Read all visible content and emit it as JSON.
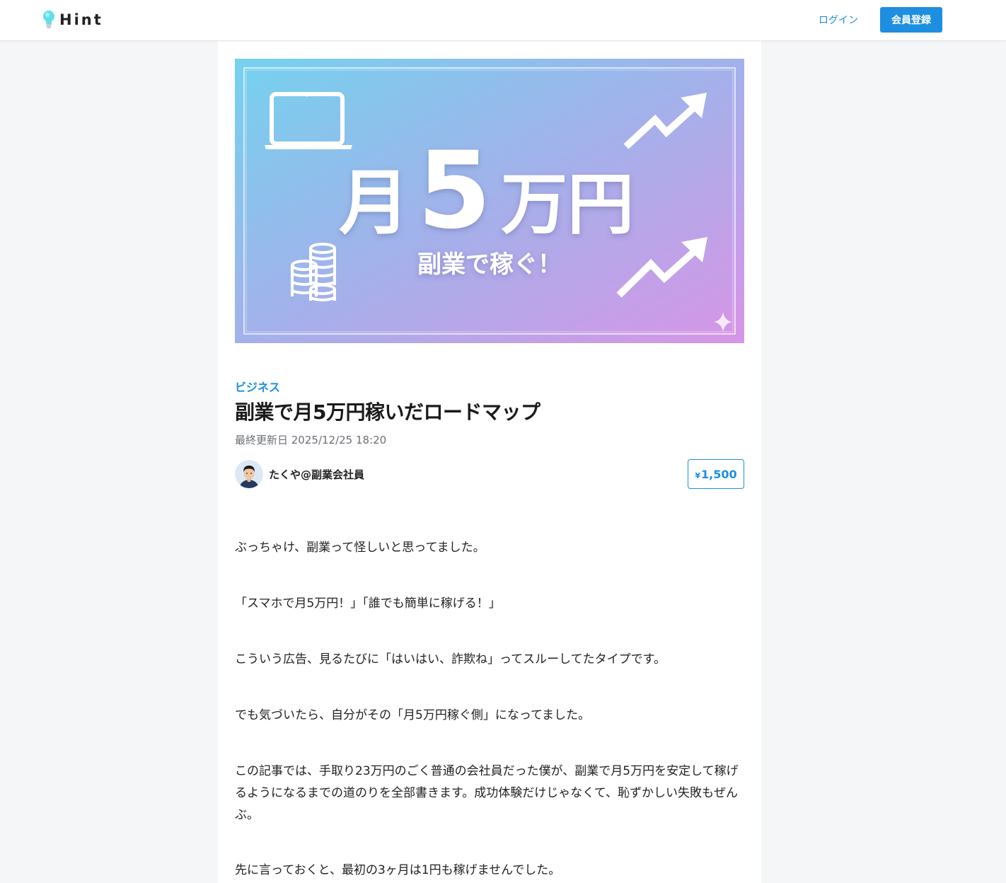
{
  "header": {
    "logo_text": "Hint",
    "login_label": "ログイン",
    "signup_label": "会員登録"
  },
  "hero": {
    "headline_month": "月",
    "headline_number": "5",
    "headline_unit": "万円",
    "subtitle": "副業で稼ぐ！",
    "gradient_start": "#74d2ee",
    "gradient_end": "#d795e6"
  },
  "article": {
    "category": "ビジネス",
    "title": "副業で月5万円稼いだロードマップ",
    "updated": "最終更新日 2025/12/25 18:20",
    "author": "たくや@副業会社員",
    "price_symbol": "¥",
    "price": "1,500",
    "paragraphs": [
      "ぶっちゃけ、副業って怪しいと思ってました。",
      "「スマホで月5万円！」「誰でも簡単に稼げる！」",
      "こういう広告、見るたびに「はいはい、詐欺ね」ってスルーしてたタイプです。",
      "でも気づいたら、自分がその「月5万円稼ぐ側」になってました。",
      "この記事では、手取り23万円のごく普通の会社員だった僕が、副業で月5万円を安定して稼げるようになるまでの道のりを全部書きます。成功体験だけじゃなくて、恥ずかしい失敗もぜんぶ。",
      "先に言っておくと、最初の3ヶ月は1円も稼げませんでした。"
    ]
  },
  "colors": {
    "accent": "#1e8fe0",
    "page_background": "#f5f6f8"
  }
}
